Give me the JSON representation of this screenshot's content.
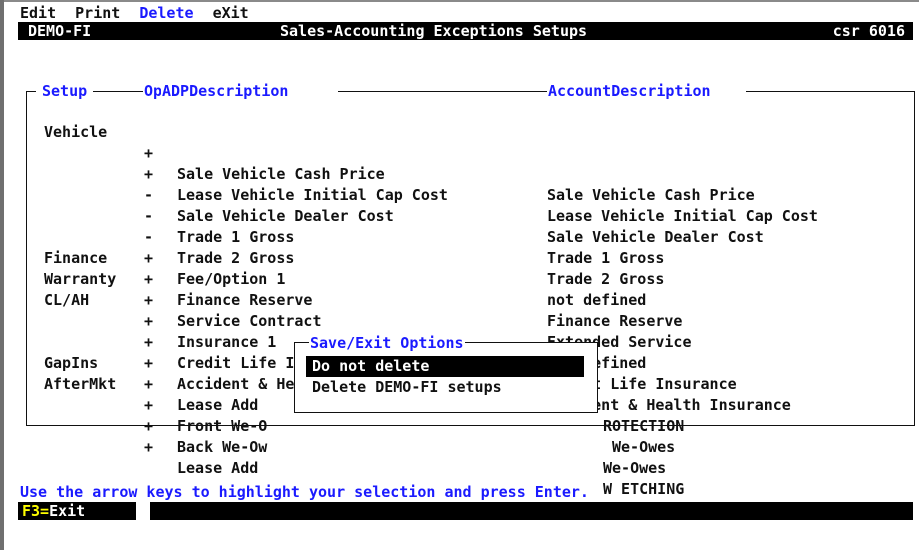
{
  "menu": [
    "Edit",
    "Print",
    "Delete",
    "eXit"
  ],
  "titlebar": {
    "app": "DEMO-FI",
    "title": "Sales-Accounting Exceptions Setups",
    "csr": "csr 6016"
  },
  "columns": {
    "setup": "Setup",
    "op": "Op",
    "adp": "ADPDescription",
    "account": "AccountDescription"
  },
  "rows": [
    {
      "setup": "Vehicle",
      "op": "+",
      "adp": "Sale Vehicle Cash Price",
      "account": "Sale Vehicle Cash Price"
    },
    {
      "setup": "",
      "op": "+",
      "adp": "Lease Vehicle Initial Cap Cost",
      "account": "Lease Vehicle Initial Cap Cost"
    },
    {
      "setup": "",
      "op": "-",
      "adp": "Sale Vehicle Dealer Cost",
      "account": "Sale Vehicle Dealer Cost"
    },
    {
      "setup": "",
      "op": "-",
      "adp": "Trade 1 Gross",
      "account": "Trade 1 Gross"
    },
    {
      "setup": "",
      "op": "-",
      "adp": "Trade 2 Gross",
      "account": "Trade 2 Gross"
    },
    {
      "setup": "",
      "op": "+",
      "adp": "Fee/Option 1",
      "account": "not defined"
    },
    {
      "setup": "Finance",
      "op": "+",
      "adp": "Finance Reserve",
      "account": "Finance Reserve"
    },
    {
      "setup": "Warranty",
      "op": "+",
      "adp": "Service Contract",
      "account": "Extended Service"
    },
    {
      "setup": "CL/AH",
      "op": "+",
      "adp": "Insurance 1",
      "account": "not defined"
    },
    {
      "setup": "",
      "op": "+",
      "adp": "Credit Life Insurance",
      "account": "Credit Life Insurance"
    },
    {
      "setup": "",
      "op": "+",
      "adp": "Accident & Health Insurance",
      "account": "Accident & Health Insurance"
    },
    {
      "setup": "GapIns",
      "op": "+",
      "adp": "Lease Add",
      "account": "ROTECTION"
    },
    {
      "setup": "AfterMkt",
      "op": "+",
      "adp": "Front We-O",
      "account": "We-Owes"
    },
    {
      "setup": "",
      "op": "+",
      "adp": "Back We-Ow",
      "account": "We-Owes"
    },
    {
      "setup": "",
      "op": "+",
      "adp": "Lease Add",
      "account": "W ETCHING"
    }
  ],
  "dialog": {
    "title": "Save/Exit Options",
    "options": [
      "Do not delete",
      "Delete DEMO-FI setups"
    ],
    "selected_index": 0
  },
  "status_message": "Use the arrow keys to highlight your selection and press Enter.",
  "fkeys": [
    {
      "key": "F3=",
      "label": "Exit"
    }
  ],
  "colors": {
    "accent": "#1a1aff",
    "bar": "#000000",
    "highlight_key": "#ffff00"
  }
}
